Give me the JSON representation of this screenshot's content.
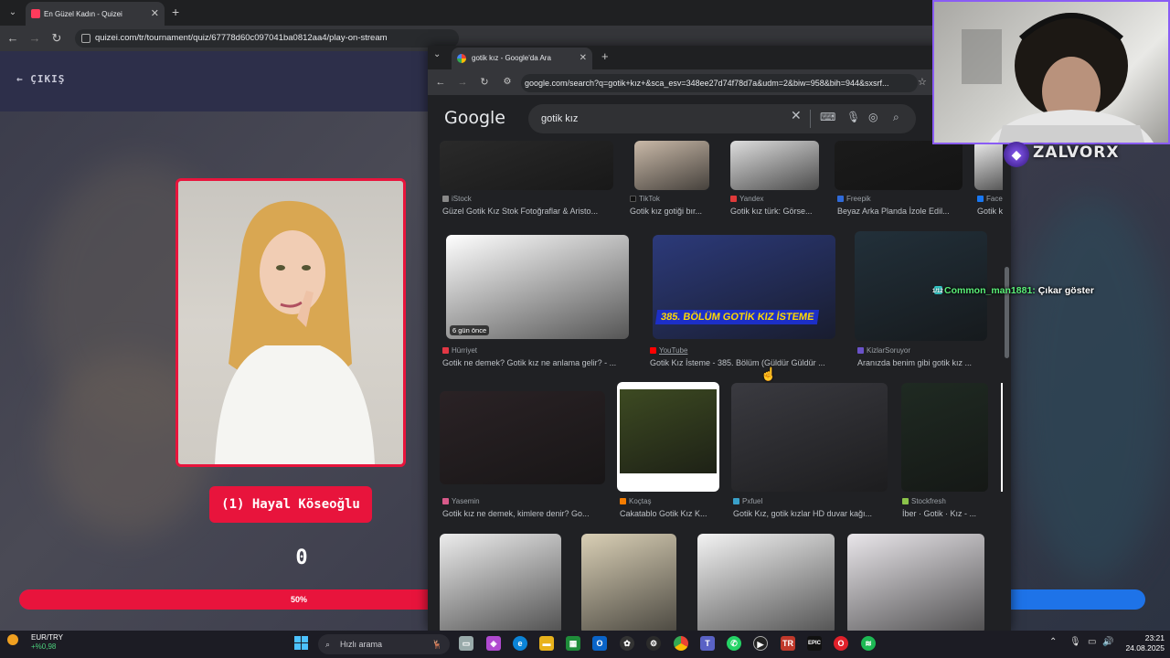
{
  "main_browser": {
    "tab_title": "En Güzel Kadın - Quizei",
    "url": "quizei.com/tr/tournament/quiz/67778d60c097041ba0812aa4/play-on-stream"
  },
  "quiz": {
    "exit_label": "ÇIKIŞ",
    "candidate_name": "(1) Hayal Köseoğlu",
    "score": "0",
    "progress_label": "50%",
    "progress_value": 0.5,
    "colors": {
      "accent_red": "#e8143c",
      "accent_blue": "#1e73e8"
    }
  },
  "popup_browser": {
    "tab_title": "gotik kız - Google'da Ara",
    "url": "google.com/search?q=gotik+kız+&sca_esv=348ee27d74f78d7a&udm=2&biw=958&bih=944&sxsrf...",
    "logo": "Google",
    "search_query": "gotik kız",
    "rows": [
      [
        {
          "source": "iStock",
          "caption": "Güzel Gotik Kız Stok Fotoğraflar & Aristo...",
          "color": "#2a2a2a"
        },
        {
          "source": "TikTok",
          "caption": "Gotik kız gotiği bır...",
          "color": "#c9b9a8"
        },
        {
          "source": "Yandex",
          "caption": "Gotik kız türk: Görse...",
          "color": "#ddd"
        },
        {
          "source": "Freepik",
          "caption": "Beyaz Arka Planda İzole Edil...",
          "color": "#1b1b1b"
        },
        {
          "source": "Face",
          "caption": "Gotik k",
          "color": "#eee"
        }
      ],
      [
        {
          "source": "Hürriyet",
          "caption": "Gotik ne demek? Gotik kız ne anlama gelir? - ...",
          "overlay": "6 gün önce",
          "color": "#fff"
        },
        {
          "source": "YouTube",
          "caption": "Gotik Kız İsteme - 385. Bölüm (Güldür Güldür ...",
          "overlay": "385. BÖLÜM GOTİK KIZ İSTEME",
          "color": "#2c3a7a"
        },
        {
          "source": "KizlarSoruyor",
          "caption": "Aranızda benim gibi gotik kız ...",
          "color": "#22303a"
        }
      ],
      [
        {
          "source": "Yasemin",
          "caption": "Gotik kız ne demek, kimlere denir? Go...",
          "color": "#2a2225"
        },
        {
          "source": "Koçtaş",
          "caption": "Cakatablo Gotik Kız K...",
          "color": "#3d4a22"
        },
        {
          "source": "Pxfuel",
          "caption": "Gotik Kız, gotik kızlar HD duvar kağı...",
          "color": "#3a3a40"
        },
        {
          "source": "Stockfresh",
          "caption": "İber · Gotik · Kız - ...",
          "color": "#1f2a22"
        }
      ],
      [
        {
          "color": "#ececec"
        },
        {
          "color": "#d9cfb5"
        },
        {
          "color": "#f3f3f3"
        },
        {
          "color": "#e9e6ea"
        }
      ]
    ]
  },
  "stream_overlay": {
    "channel_name": "ZALVORX",
    "chat_user": "Common_man1881:",
    "chat_message": "Çıkar göster",
    "chat_badge": "1/12"
  },
  "taskbar": {
    "ticker_name": "EUR/TRY",
    "ticker_change": "+%0,98",
    "search_placeholder": "Hızlı arama",
    "time": "23:21",
    "date": "24.08.2025"
  }
}
